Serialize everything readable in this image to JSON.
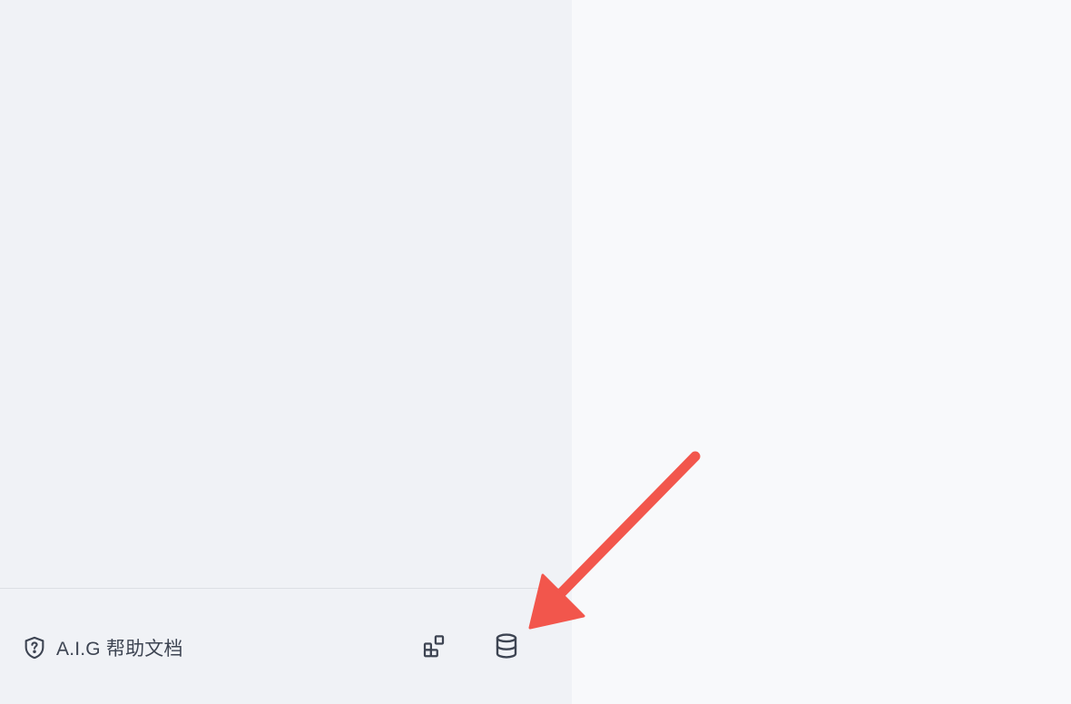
{
  "sidebar": {
    "footer": {
      "help_link": {
        "label": "A.I.G 帮助文档",
        "icon": "shield-question-icon"
      },
      "plugins_button": {
        "icon": "plugins-grid-icon"
      },
      "database_button": {
        "icon": "database-icon"
      }
    }
  },
  "annotation": {
    "type": "arrow",
    "target": "database-button",
    "color": "#f2564c"
  },
  "colors": {
    "sidebar_bg": "#f0f2f6",
    "main_bg": "#f8f9fb",
    "text": "#3d4452",
    "divider": "#dcdfe5"
  }
}
